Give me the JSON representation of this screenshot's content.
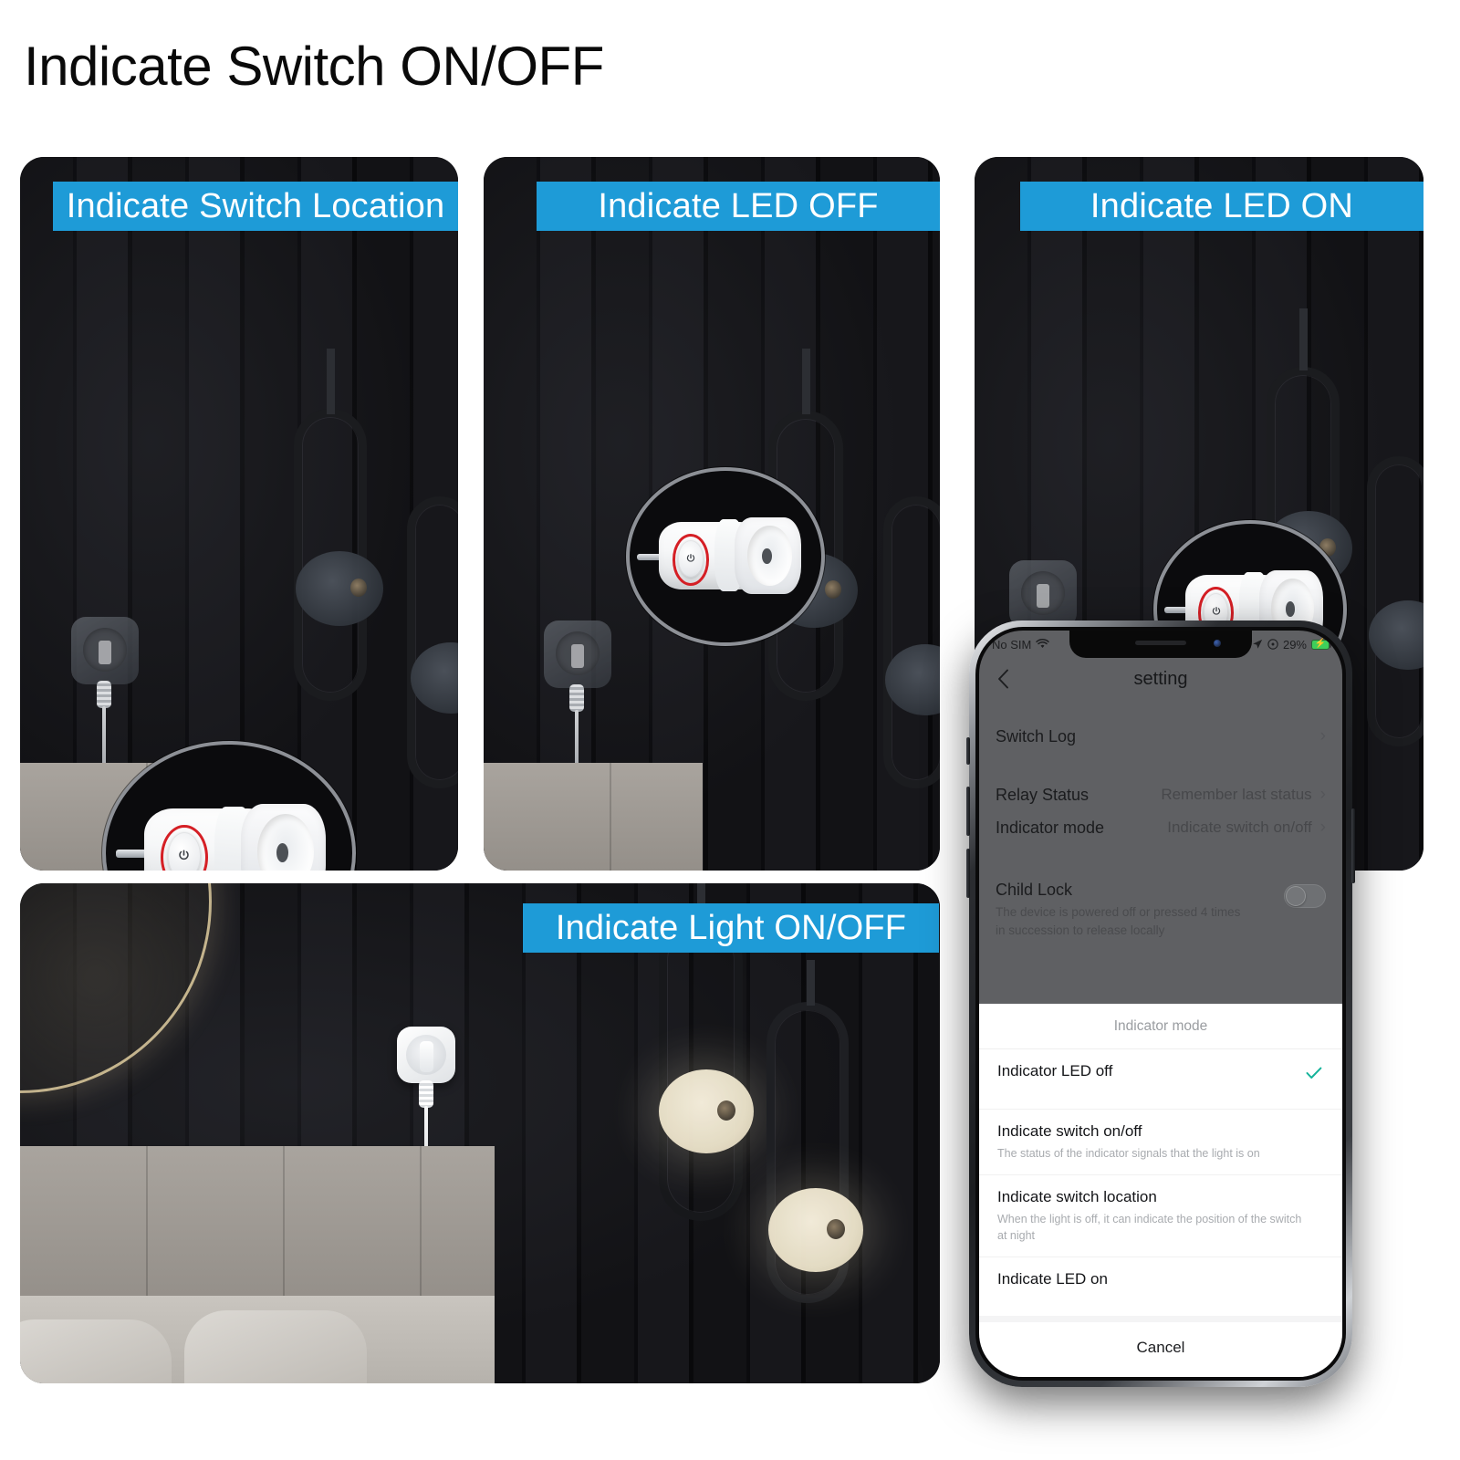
{
  "page": {
    "title": "Indicate Switch ON/OFF",
    "accent_blue": "#1e9bd7",
    "ring_red": "#d51f25",
    "check_green": "#14b39a"
  },
  "panels": [
    {
      "id": "switch-location",
      "badge": "Indicate Switch Location"
    },
    {
      "id": "led-off",
      "badge": "Indicate LED OFF"
    },
    {
      "id": "led-on",
      "badge": "Indicate LED ON"
    },
    {
      "id": "light-onoff",
      "badge": "Indicate Light ON/OFF"
    }
  ],
  "phone": {
    "status_bar": {
      "carrier": "No SIM",
      "wifi_icon": "wifi-icon",
      "location_icon": "location-arrow-icon",
      "alarm_icon": "clock-icon",
      "battery_percent": "29%",
      "battery_icon": "battery-charging-icon"
    },
    "nav": {
      "back_icon": "chevron-left-icon",
      "title": "setting"
    },
    "settings_rows": [
      {
        "label": "Switch Log",
        "value": "",
        "chevron": "›",
        "desc": "",
        "toggle": false
      },
      {
        "label": "Relay Status",
        "value": "Remember last status",
        "chevron": "›",
        "desc": "",
        "toggle": false
      },
      {
        "label": "Indicator mode",
        "value": "Indicate switch on/off",
        "chevron": "›",
        "desc": "",
        "toggle": false
      },
      {
        "label": "Child Lock",
        "value": "",
        "chevron": "",
        "desc": "The device is powered off or pressed 4 times in succession to release locally",
        "toggle": true
      }
    ],
    "sheet": {
      "title": "Indicator mode",
      "options": [
        {
          "label": "Indicator LED off",
          "desc": "",
          "checked": true
        },
        {
          "label": "Indicate switch on/off",
          "desc": "The status of the indicator signals that the light is on",
          "checked": false
        },
        {
          "label": "Indicate switch location",
          "desc": "When the light is off, it can indicate the position of the switch at night",
          "checked": false
        },
        {
          "label": "Indicate LED on",
          "desc": "",
          "checked": false
        }
      ],
      "cancel_label": "Cancel"
    }
  }
}
